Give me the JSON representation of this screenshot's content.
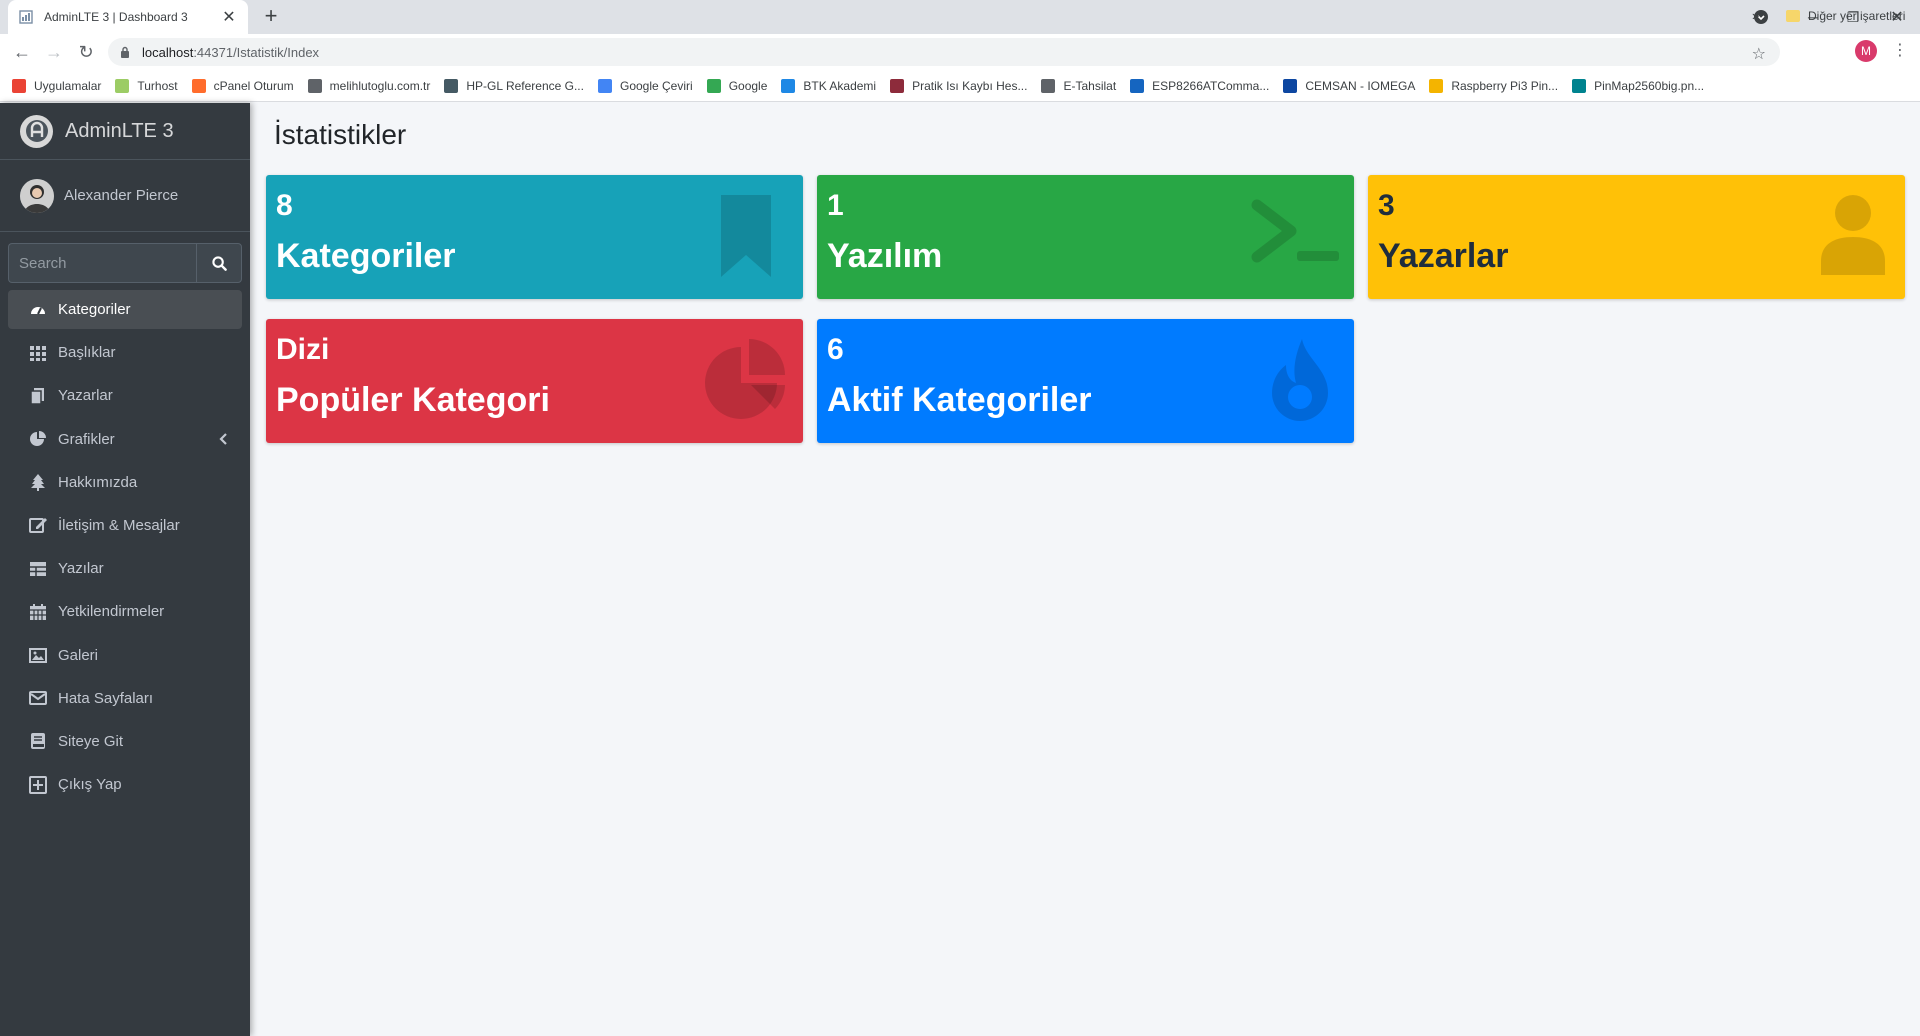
{
  "browser": {
    "tab_title": "AdminLTE 3 | Dashboard 3",
    "url_host": "localhost",
    "url_rest": ":44371/Istatistik/Index",
    "profile_initial": "M",
    "bookmarks": [
      {
        "label": "Uygulamalar",
        "color": "#ea4335"
      },
      {
        "label": "Turhost",
        "color": "#9ccc65"
      },
      {
        "label": "cPanel Oturum",
        "color": "#ff6c2c"
      },
      {
        "label": "melihlutoglu.com.tr",
        "color": "#5f6368"
      },
      {
        "label": "HP-GL Reference G...",
        "color": "#455a64"
      },
      {
        "label": "Google Çeviri",
        "color": "#4285f4"
      },
      {
        "label": "Google",
        "color": "#34a853"
      },
      {
        "label": "BTK Akademi",
        "color": "#1e88e5"
      },
      {
        "label": "Pratik Isı Kaybı Hes...",
        "color": "#8d2b3b"
      },
      {
        "label": "E-Tahsilat",
        "color": "#5f6368"
      },
      {
        "label": "ESP8266ATComma...",
        "color": "#1565c0"
      },
      {
        "label": "CEMSAN - IOMEGA",
        "color": "#0d47a1"
      },
      {
        "label": "Raspberry Pi3 Pin...",
        "color": "#f4b400"
      },
      {
        "label": "PinMap2560big.pn...",
        "color": "#00838f"
      }
    ],
    "more_label": "»",
    "other_bookmarks": "Diğer yer işaretleri"
  },
  "sidebar": {
    "brand": "AdminLTE 3",
    "user_name": "Alexander Pierce",
    "search_placeholder": "Search",
    "items": [
      {
        "label": "Kategoriler",
        "icon": "tachometer-icon",
        "active": true
      },
      {
        "label": "Başlıklar",
        "icon": "th-icon"
      },
      {
        "label": "Yazarlar",
        "icon": "copy-icon"
      },
      {
        "label": "Grafikler",
        "icon": "chart-pie-icon",
        "has_children": true
      },
      {
        "label": "Hakkımızda",
        "icon": "tree-icon"
      },
      {
        "label": "İletişim & Mesajlar",
        "icon": "edit-icon"
      },
      {
        "label": "Yazılar",
        "icon": "table-icon"
      },
      {
        "label": "Yetkilendirmeler",
        "icon": "calendar-icon"
      },
      {
        "label": "Galeri",
        "icon": "image-icon"
      },
      {
        "label": "Hata Sayfaları",
        "icon": "envelope-icon"
      },
      {
        "label": "Siteye Git",
        "icon": "book-icon"
      },
      {
        "label": "Çıkış Yap",
        "icon": "plus-square-icon"
      }
    ]
  },
  "main": {
    "title": "İstatistikler",
    "boxes": [
      {
        "value": "8",
        "label": "Kategoriler",
        "icon": "bookmark-icon",
        "color": "#17a2b8"
      },
      {
        "value": "1",
        "label": "Yazılım",
        "icon": "terminal-icon",
        "color": "#28a745"
      },
      {
        "value": "3",
        "label": "Yazarlar",
        "icon": "user-icon",
        "color": "#ffc107"
      },
      {
        "value": "Dizi",
        "label": "Popüler Kategori",
        "icon": "chart-pie-icon",
        "color": "#dc3545"
      },
      {
        "value": "6",
        "label": "Aktif Kategoriler",
        "icon": "fire-icon",
        "color": "#007bff"
      }
    ]
  }
}
